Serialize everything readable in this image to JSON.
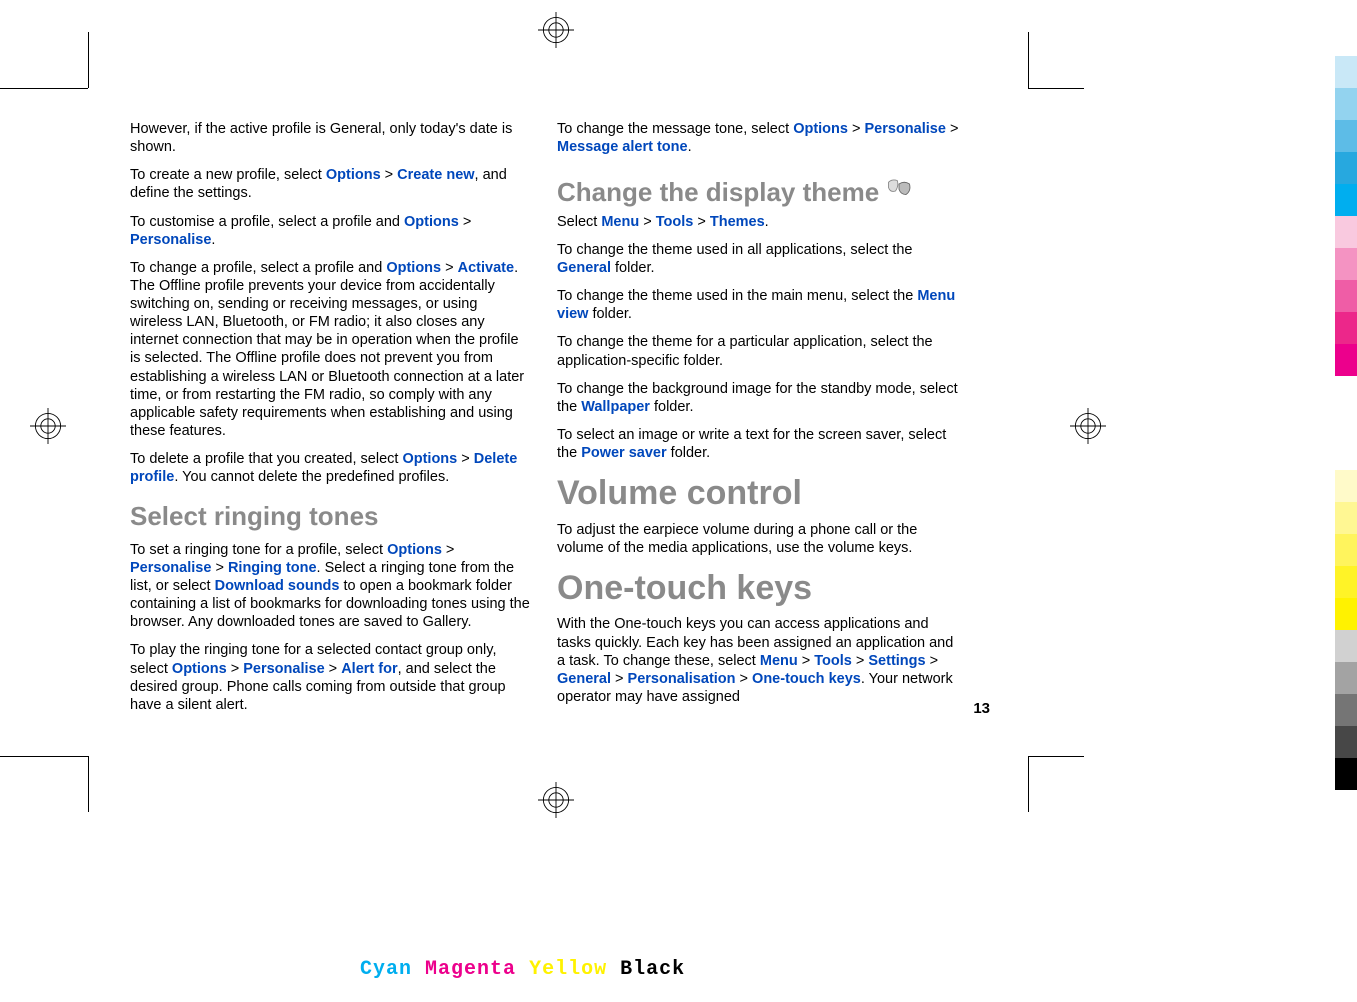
{
  "page_number": "13",
  "footer": {
    "cyan": "Cyan",
    "magenta": "Magenta",
    "yellow": "Yellow",
    "black": "Black"
  },
  "left": {
    "p1": "However, if the active profile is General, only today's date is shown.",
    "p2a": "To create a new profile, select ",
    "p2_opt": "Options",
    "p2_gt": " > ",
    "p2_create": "Create new",
    "p2b": ", and define the settings.",
    "p3a": "To customise a profile, select a profile and ",
    "p3_opt": "Options",
    "p3_gt": " > ",
    "p3_pers": "Personalise",
    "p3b": ".",
    "p4a": "To change a profile, select a profile and ",
    "p4_opt": "Options",
    "p4_gt": " > ",
    "p4_act": "Activate",
    "p4b": ". The Offline profile prevents your device from accidentally switching on, sending or receiving messages, or using wireless LAN, Bluetooth, or FM radio; it also closes any internet connection that may be in operation when the profile is selected. The Offline profile does not prevent you from establishing a wireless LAN or Bluetooth connection at a later time, or from restarting the FM radio, so comply with any applicable safety requirements when establishing and using these features.",
    "p5a": "To delete a profile that you created, select ",
    "p5_opt": "Options",
    "p5_gt": " > ",
    "p5_del": "Delete profile",
    "p5b": ". You cannot delete the predefined profiles.",
    "h2_ringing": "Select ringing tones",
    "p6a": "To set a ringing tone for a profile, select ",
    "p6_opt": "Options",
    "p6_gt1": " > ",
    "p6_pers": "Personalise",
    "p6_gt2": " > ",
    "p6_ring": "Ringing tone",
    "p6b": ". Select a ringing tone from the list, or select ",
    "p6_dl": "Download sounds",
    "p6c": " to open a bookmark folder containing a list of bookmarks for downloading tones using the browser. Any downloaded tones are saved to Gallery.",
    "p7a": "To play the ringing tone for a selected contact group only, select ",
    "p7_opt": "Options",
    "p7_gt1": " > ",
    "p7_pers": "Personalise",
    "p7_gt2": " > ",
    "p7_alert": "Alert for",
    "p7b": ", and select the desired group. Phone calls coming from outside that group have a silent alert."
  },
  "right": {
    "p1a": "To change the message tone, select ",
    "p1_opt": "Options",
    "p1_gt1": " > ",
    "p1_pers": "Personalise",
    "p1_gt2": " > ",
    "p1_msg": "Message alert tone",
    "p1b": ".",
    "h2_theme": "Change the display theme",
    "p2a": "Select ",
    "p2_menu": "Menu",
    "p2_gt1": " > ",
    "p2_tools": "Tools",
    "p2_gt2": " > ",
    "p2_themes": "Themes",
    "p2b": ".",
    "p3a": "To change the theme used in all applications, select the ",
    "p3_gen": "General",
    "p3b": " folder.",
    "p4a": "To change the theme used in the main menu, select the ",
    "p4_mv": "Menu view",
    "p4b": " folder.",
    "p5": "To change the theme for a particular application, select the application-specific folder.",
    "p6a": "To change the background image for the standby mode, select the ",
    "p6_wp": "Wallpaper",
    "p6b": " folder.",
    "p7a": "To select an image or write a text for the screen saver, select the ",
    "p7_ps": "Power saver",
    "p7b": " folder.",
    "h1_volume": "Volume control",
    "p8": "To adjust the earpiece volume during a phone call or the volume of the media applications, use the volume keys.",
    "h1_onetouch": "One-touch keys",
    "p9a": "With the One-touch keys you can access applications and tasks quickly. Each key has been assigned an application and a task. To change these, select ",
    "p9_menu": "Menu",
    "p9_gt1": " > ",
    "p9_tools": "Tools",
    "p9_gt2": " > ",
    "p9_set": "Settings",
    "p9_gt3": " > ",
    "p9_gen": "General",
    "p9_gt4": " > ",
    "p9_pers": "Personalisation",
    "p9_gt5": " > ",
    "p9_otk": "One-touch keys",
    "p9b": ". Your network operator may have assigned"
  }
}
